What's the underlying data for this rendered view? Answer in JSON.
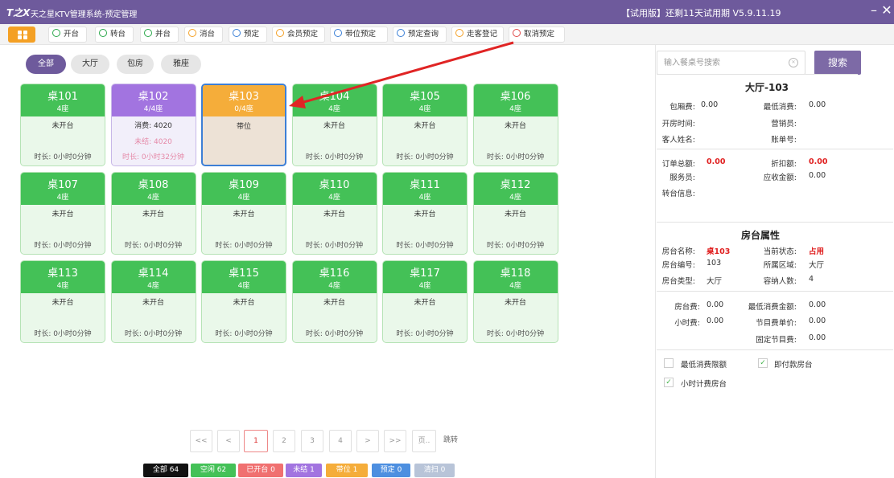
{
  "window": {
    "logo": "T之X",
    "title": "天之星KTV管理系统-预定管理",
    "trial": "【试用版】还剩11天试用期 V5.9.11.19",
    "minimize": "–",
    "close": "✕"
  },
  "toolbar": {
    "buttons": [
      {
        "label": "开台",
        "icon": "play-circle-icon",
        "color": "#2aa84a"
      },
      {
        "label": "转台",
        "icon": "transfer-icon",
        "color": "#2aa84a"
      },
      {
        "label": "并台",
        "icon": "merge-icon",
        "color": "#2aa84a"
      },
      {
        "label": "消台",
        "icon": "clear-table-icon",
        "color": "#f4a024"
      },
      {
        "label": "预定",
        "icon": "calendar-icon",
        "color": "#3a7fd6"
      },
      {
        "label": "会员预定",
        "icon": "member-icon",
        "color": "#f4a024"
      },
      {
        "label": "带位预定",
        "icon": "seat-guide-icon",
        "color": "#3a7fd6"
      },
      {
        "label": "预定查询",
        "icon": "query-icon",
        "color": "#3a7fd6"
      },
      {
        "label": "走客登记",
        "icon": "walk-in-icon",
        "color": "#f4a024"
      },
      {
        "label": "取消预定",
        "icon": "cancel-icon",
        "color": "#e04848"
      }
    ]
  },
  "filters": [
    "全部",
    "大厅",
    "包房",
    "雅座"
  ],
  "tables": [
    {
      "name": "桌101",
      "seats": "4座",
      "status": "未开台",
      "duration": "时长: 0小时0分钟",
      "state": "free"
    },
    {
      "name": "桌102",
      "seats": "4/4座",
      "status": "消费: 4020",
      "extra": "未结: 4020",
      "duration": "时长: 0小时32分钟",
      "state": "unsettled"
    },
    {
      "name": "桌103",
      "seats": "0/4座",
      "status": "带位",
      "duration": "",
      "state": "guided"
    },
    {
      "name": "桌104",
      "seats": "4座",
      "status": "未开台",
      "duration": "时长: 0小时0分钟",
      "state": "free"
    },
    {
      "name": "桌105",
      "seats": "4座",
      "status": "未开台",
      "duration": "时长: 0小时0分钟",
      "state": "free"
    },
    {
      "name": "桌106",
      "seats": "4座",
      "status": "未开台",
      "duration": "时长: 0小时0分钟",
      "state": "free"
    },
    {
      "name": "桌107",
      "seats": "4座",
      "status": "未开台",
      "duration": "时长: 0小时0分钟",
      "state": "free"
    },
    {
      "name": "桌108",
      "seats": "4座",
      "status": "未开台",
      "duration": "时长: 0小时0分钟",
      "state": "free"
    },
    {
      "name": "桌109",
      "seats": "4座",
      "status": "未开台",
      "duration": "时长: 0小时0分钟",
      "state": "free"
    },
    {
      "name": "桌110",
      "seats": "4座",
      "status": "未开台",
      "duration": "时长: 0小时0分钟",
      "state": "free"
    },
    {
      "name": "桌111",
      "seats": "4座",
      "status": "未开台",
      "duration": "时长: 0小时0分钟",
      "state": "free"
    },
    {
      "name": "桌112",
      "seats": "4座",
      "status": "未开台",
      "duration": "时长: 0小时0分钟",
      "state": "free"
    },
    {
      "name": "桌113",
      "seats": "4座",
      "status": "未开台",
      "duration": "时长: 0小时0分钟",
      "state": "free"
    },
    {
      "name": "桌114",
      "seats": "4座",
      "status": "未开台",
      "duration": "时长: 0小时0分钟",
      "state": "free"
    },
    {
      "name": "桌115",
      "seats": "4座",
      "status": "未开台",
      "duration": "时长: 0小时0分钟",
      "state": "free"
    },
    {
      "name": "桌116",
      "seats": "4座",
      "status": "未开台",
      "duration": "时长: 0小时0分钟",
      "state": "free"
    },
    {
      "name": "桌117",
      "seats": "4座",
      "status": "未开台",
      "duration": "时长: 0小时0分钟",
      "state": "free"
    },
    {
      "name": "桌118",
      "seats": "4座",
      "status": "未开台",
      "duration": "时长: 0小时0分钟",
      "state": "free"
    }
  ],
  "pagination": {
    "first": "<<",
    "prev": "<",
    "pages": [
      "1",
      "2",
      "3",
      "4"
    ],
    "current": "1",
    "next": ">",
    "last": ">>",
    "page_input": "页..",
    "jump": "跳转"
  },
  "legend": [
    {
      "label": "全部 64",
      "color": "#111111"
    },
    {
      "label": "空闲 62",
      "color": "#44c157"
    },
    {
      "label": "已开台 0",
      "color": "#f07070"
    },
    {
      "label": "未结 1",
      "color": "#a274e0"
    },
    {
      "label": "带位 1",
      "color": "#f5ad3a"
    },
    {
      "label": "预定 0",
      "color": "#4d8fe0"
    },
    {
      "label": "清扫 0",
      "color": "#b8c4d8"
    }
  ],
  "search": {
    "placeholder": "输入餐桌号搜索",
    "button": "搜索"
  },
  "detail": {
    "title": "大厅-103",
    "room_fee_label": "包厢费:",
    "room_fee": "0.00",
    "min_spend_label": "最低消费:",
    "min_spend": "0.00",
    "open_time_label": "开房时间:",
    "open_time": "",
    "sales_label": "营销员:",
    "sales": "",
    "guest_label": "客人姓名:",
    "guest": "",
    "bill_no_label": "账单号:",
    "bill_no": "",
    "order_total_label": "订单总额:",
    "order_total": "0.00",
    "discount_label": "折扣额:",
    "discount": "0.00",
    "waiter_label": "服务员:",
    "waiter": "",
    "receivable_label": "应收金额:",
    "receivable": "0.00",
    "transfer_label": "转台信息:",
    "transfer": ""
  },
  "room": {
    "title": "房台属性",
    "name_label": "房台名称:",
    "name": "桌103",
    "state_label": "当前状态:",
    "state": "占用",
    "code_label": "房台编号:",
    "code": "103",
    "area_label": "所属区域:",
    "area": "大厅",
    "type_label": "房台类型:",
    "type": "大厅",
    "capacity_label": "容纳人数:",
    "capacity": "4",
    "fee_label": "房台费:",
    "fee": "0.00",
    "min_total_label": "最低消费金额:",
    "min_total": "0.00",
    "hourly_label": "小时费:",
    "hourly": "0.00",
    "program_unit_label": "节目费单价:",
    "program_unit": "0.00",
    "fixed_program_label": "固定节目费:",
    "fixed_program": "0.00"
  },
  "options": [
    {
      "label": "最低消费限额",
      "checked": false
    },
    {
      "label": "即付款房台",
      "checked": true
    },
    {
      "label": "小时计费房台",
      "checked": true
    }
  ],
  "colors": {
    "accent": "#6e5a9c",
    "free": "#44c157",
    "unsettled": "#a274e0",
    "guided": "#f5ad3a",
    "selected_border": "#3d7fd6",
    "alert_red": "#e02020"
  }
}
